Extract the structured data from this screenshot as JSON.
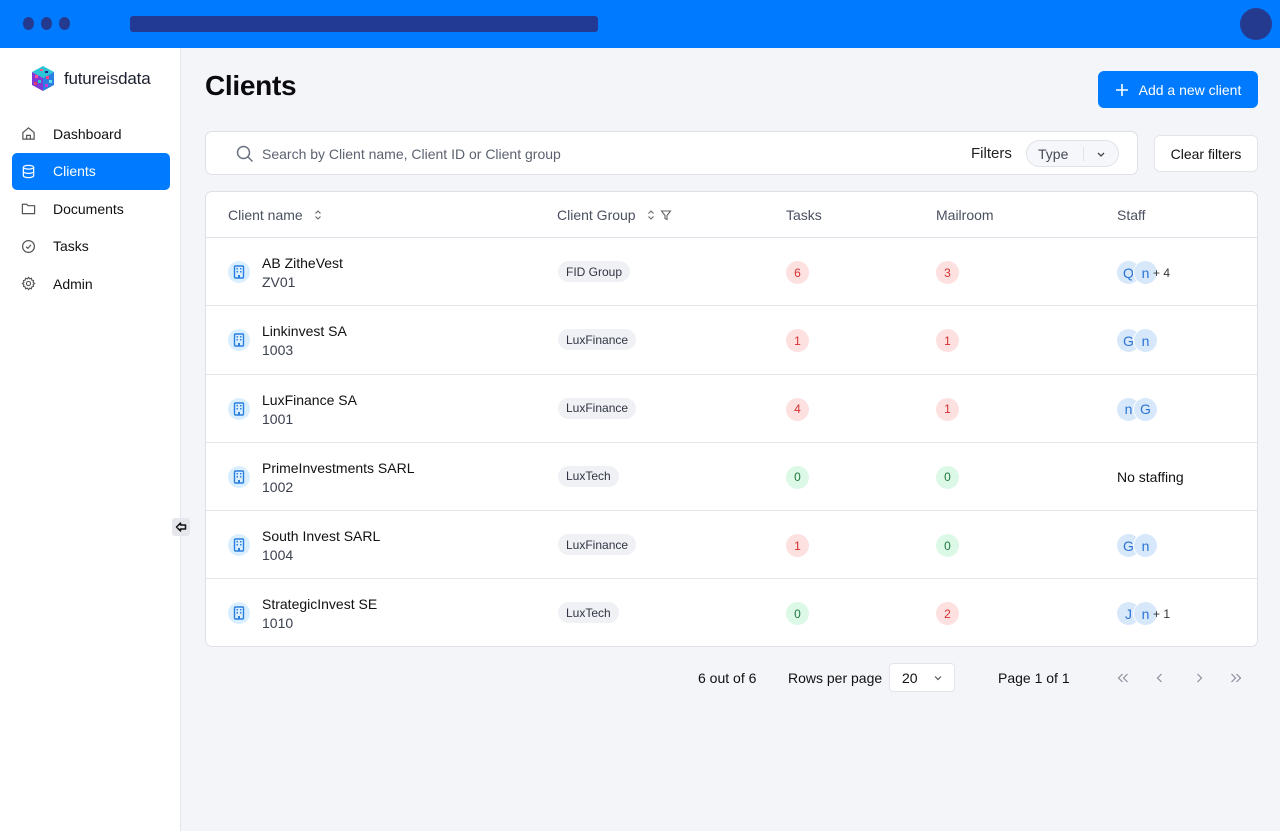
{
  "browser": {
    "window_dots": 3
  },
  "app": {
    "logo_text_a": "future",
    "logo_text_b": "is",
    "logo_text_c": "data"
  },
  "sidebar": {
    "items": [
      {
        "label": "Dashboard",
        "icon": "home-icon",
        "active": false
      },
      {
        "label": "Clients",
        "icon": "database-icon",
        "active": true
      },
      {
        "label": "Documents",
        "icon": "folder-icon",
        "active": false
      },
      {
        "label": "Tasks",
        "icon": "check-circle-icon",
        "active": false
      },
      {
        "label": "Admin",
        "icon": "gear-icon",
        "active": false
      }
    ]
  },
  "header": {
    "title": "Clients",
    "add_button": "Add a new client"
  },
  "search": {
    "placeholder": "Search by Client name, Client ID or Client group",
    "value": "",
    "filters_label": "Filters",
    "type_filter": "Type",
    "clear_filters": "Clear filters"
  },
  "table": {
    "columns": {
      "client_name": "Client name",
      "client_group": "Client Group",
      "tasks": "Tasks",
      "mailroom": "Mailroom",
      "staff": "Staff"
    },
    "rows": [
      {
        "name": "AB ZitheVest",
        "id": "ZV01",
        "group": "FID Group",
        "tasks": "6",
        "tasks_status": "red",
        "mailroom": "3",
        "mailroom_status": "red",
        "staff": [
          "Q",
          "n"
        ],
        "staff_more": "+ 4"
      },
      {
        "name": "Linkinvest SA",
        "id": "1003",
        "group": "LuxFinance",
        "tasks": "1",
        "tasks_status": "red",
        "mailroom": "1",
        "mailroom_status": "red",
        "staff": [
          "G",
          "n"
        ],
        "staff_more": ""
      },
      {
        "name": "LuxFinance SA",
        "id": "1001",
        "group": "LuxFinance",
        "tasks": "4",
        "tasks_status": "red",
        "mailroom": "1",
        "mailroom_status": "red",
        "staff": [
          "n",
          "G"
        ],
        "staff_more": ""
      },
      {
        "name": "PrimeInvestments SARL",
        "id": "1002",
        "group": "LuxTech",
        "tasks": "0",
        "tasks_status": "green",
        "mailroom": "0",
        "mailroom_status": "green",
        "staff": [],
        "staff_more": "",
        "no_staff": "No staffing"
      },
      {
        "name": "South Invest SARL",
        "id": "1004",
        "group": "LuxFinance",
        "tasks": "1",
        "tasks_status": "red",
        "mailroom": "0",
        "mailroom_status": "green",
        "staff": [
          "G",
          "n"
        ],
        "staff_more": ""
      },
      {
        "name": "StrategicInvest SE",
        "id": "1010",
        "group": "LuxTech",
        "tasks": "0",
        "tasks_status": "green",
        "mailroom": "2",
        "mailroom_status": "red",
        "staff": [
          "J",
          "n"
        ],
        "staff_more": "+ 1"
      }
    ]
  },
  "pagination": {
    "count": "6 out of 6",
    "rows_per_page_label": "Rows per page",
    "rows_per_page": "20",
    "page": "Page 1 of 1"
  },
  "colors": {
    "accent": "#007bff",
    "topbar_dark": "#243a8f",
    "badge_red_bg": "#fde0e0",
    "badge_red_text": "#d63131",
    "badge_green_bg": "#dcf8e6",
    "badge_green_text": "#1f7a3f",
    "avatar_bg": "#d8e8fb",
    "avatar_text": "#2a74d6"
  }
}
